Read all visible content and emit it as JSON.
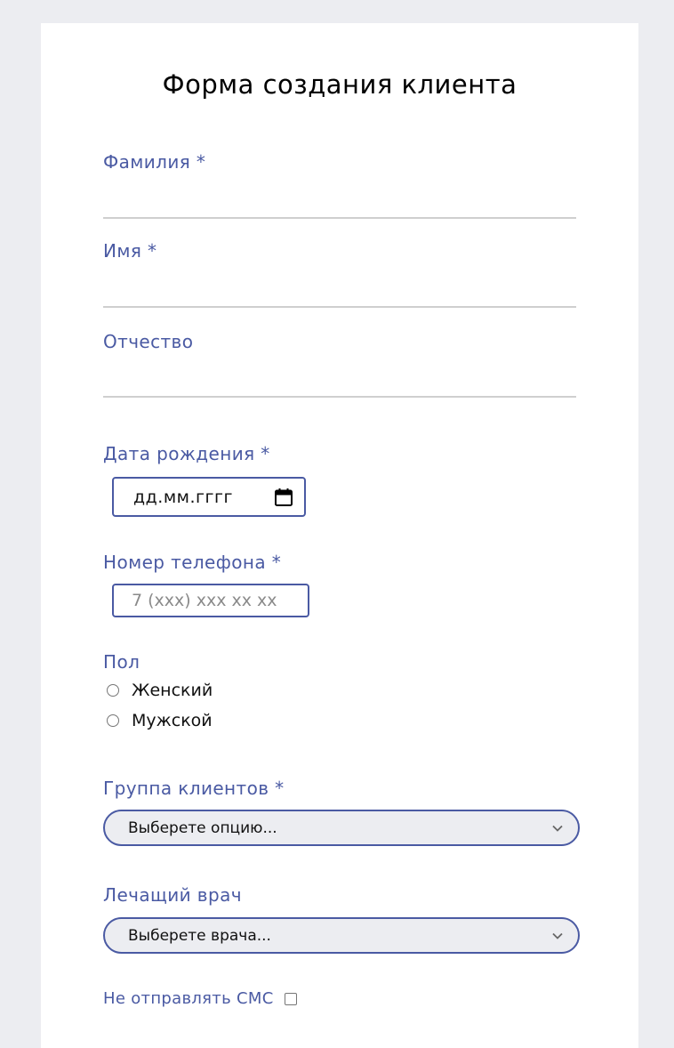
{
  "form": {
    "title": "Форма создания клиента",
    "last_name": {
      "label": "Фамилия *",
      "value": ""
    },
    "first_name": {
      "label": "Имя *",
      "value": ""
    },
    "middle_name": {
      "label": "Отчество",
      "value": ""
    },
    "birth_date": {
      "label": "Дата рождения *",
      "placeholder": "дд.мм.гггг",
      "icon": "calendar-icon"
    },
    "phone": {
      "label": "Номер телефона *",
      "placeholder": "7 (xxx) xxx xx xx"
    },
    "gender": {
      "label": "Пол",
      "options": [
        "Женский",
        "Мужской"
      ]
    },
    "client_group": {
      "label": "Группа клиентов *",
      "selected": "Выберете опцию...",
      "icon": "chevron-down-icon"
    },
    "doctor": {
      "label": "Лечащий врач",
      "selected": "Выберете врача...",
      "icon": "chevron-down-icon"
    },
    "no_sms": {
      "label": "Не отправлять СМС",
      "checked": false
    }
  },
  "colors": {
    "background": "#ECEDF1",
    "card": "#FFFFFF",
    "accent": "#4A5AA3",
    "underline": "#CFCFCF",
    "text": "#111111",
    "placeholder": "#8A8A8A"
  }
}
